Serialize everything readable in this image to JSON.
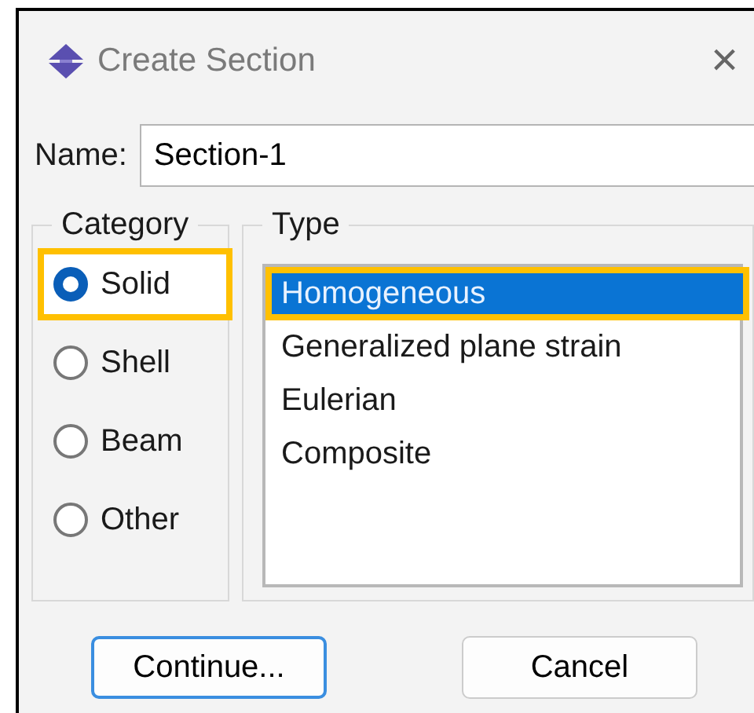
{
  "window": {
    "title": "Create Section",
    "close": "×"
  },
  "name_field": {
    "label": "Name:",
    "value": "Section-1"
  },
  "category": {
    "title": "Category",
    "options": [
      {
        "label": "Solid",
        "selected": true,
        "highlighted": true
      },
      {
        "label": "Shell",
        "selected": false,
        "highlighted": false
      },
      {
        "label": "Beam",
        "selected": false,
        "highlighted": false
      },
      {
        "label": "Other",
        "selected": false,
        "highlighted": false
      }
    ]
  },
  "type": {
    "title": "Type",
    "items": [
      {
        "label": "Homogeneous",
        "selected": true,
        "highlighted": true
      },
      {
        "label": "Generalized plane strain",
        "selected": false,
        "highlighted": false
      },
      {
        "label": "Eulerian",
        "selected": false,
        "highlighted": false
      },
      {
        "label": "Composite",
        "selected": false,
        "highlighted": false
      }
    ]
  },
  "buttons": [
    {
      "label": "Continue...",
      "default": true
    },
    {
      "label": "Cancel",
      "default": false
    }
  ]
}
